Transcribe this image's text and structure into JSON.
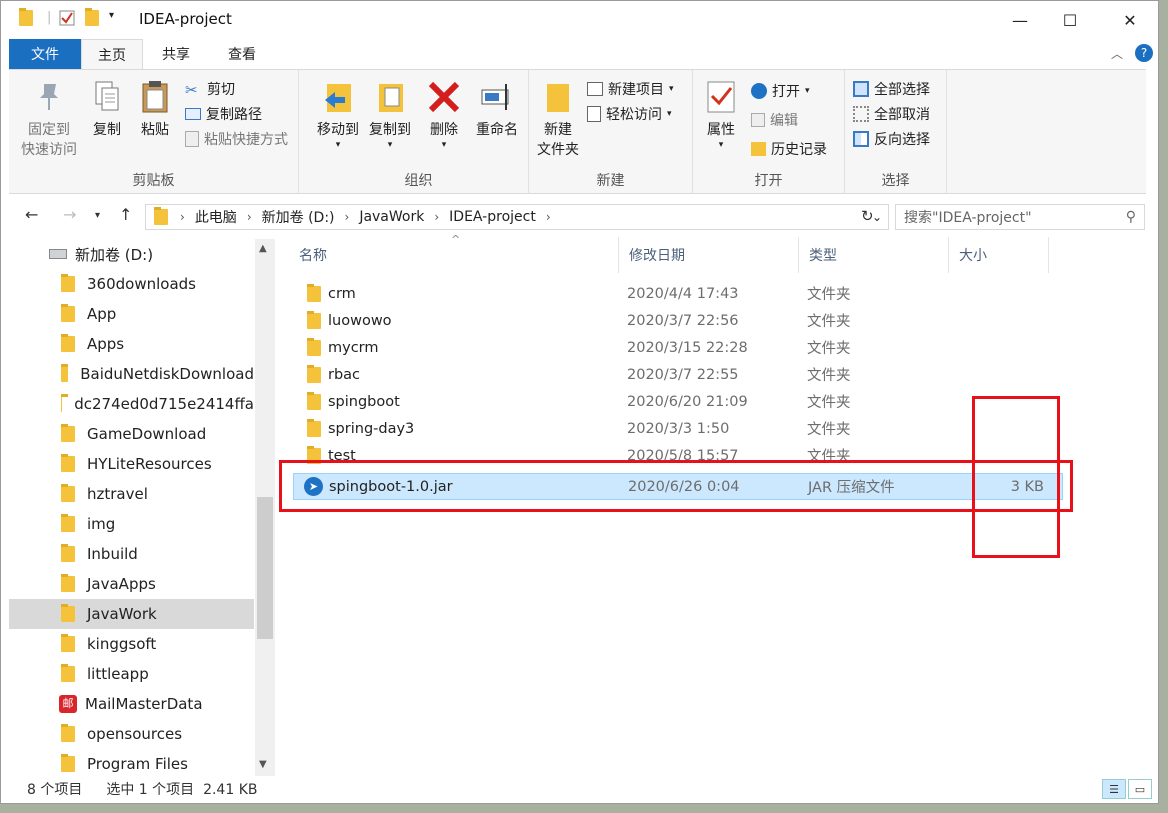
{
  "window": {
    "title": "IDEA-project"
  },
  "tabs": {
    "file": "文件",
    "home": "主页",
    "share": "共享",
    "view": "查看"
  },
  "ribbon": {
    "clipboard": {
      "group_label": "剪贴板",
      "pin": [
        "固定到",
        "快速访问"
      ],
      "copy": "复制",
      "paste": "粘贴",
      "cut": "剪切",
      "copy_path": "复制路径",
      "paste_shortcut": "粘贴快捷方式"
    },
    "organize": {
      "group_label": "组织",
      "move_to": "移动到",
      "copy_to": "复制到",
      "delete": "删除",
      "rename": "重命名"
    },
    "new": {
      "group_label": "新建",
      "new_folder": [
        "新建",
        "文件夹"
      ],
      "new_item": "新建项目",
      "easy_access": "轻松访问"
    },
    "open": {
      "group_label": "打开",
      "properties": "属性",
      "open": "打开",
      "edit": "编辑",
      "history": "历史记录"
    },
    "select": {
      "group_label": "选择",
      "select_all": "全部选择",
      "select_none": "全部取消",
      "invert": "反向选择"
    }
  },
  "address": {
    "crumbs": [
      "此电脑",
      "新加卷 (D:)",
      "JavaWork",
      "IDEA-project"
    ],
    "search_placeholder": "搜索\"IDEA-project\""
  },
  "nav": {
    "drive": "新加卷 (D:)",
    "items": [
      "360downloads",
      "App",
      "Apps",
      "BaiduNetdiskDownload",
      "dc274ed0d715e2414ffa",
      "GameDownload",
      "HYLiteResources",
      "hztravel",
      "img",
      "Inbuild",
      "JavaApps",
      "JavaWork",
      "kinggsoft",
      "littleapp",
      "MailMasterData",
      "opensources",
      "Program Files"
    ],
    "selected": "JavaWork",
    "mail_icon_text": "邮"
  },
  "columns": {
    "name": "名称",
    "date": "修改日期",
    "type": "类型",
    "size": "大小"
  },
  "files": [
    {
      "name": "crm",
      "date": "2020/4/4 17:43",
      "type": "文件夹",
      "size": ""
    },
    {
      "name": "luowowo",
      "date": "2020/3/7 22:56",
      "type": "文件夹",
      "size": ""
    },
    {
      "name": "mycrm",
      "date": "2020/3/15 22:28",
      "type": "文件夹",
      "size": ""
    },
    {
      "name": "rbac",
      "date": "2020/3/7 22:55",
      "type": "文件夹",
      "size": ""
    },
    {
      "name": "spingboot",
      "date": "2020/6/20 21:09",
      "type": "文件夹",
      "size": ""
    },
    {
      "name": "spring-day3",
      "date": "2020/3/3 1:50",
      "type": "文件夹",
      "size": ""
    },
    {
      "name": "test",
      "date": "2020/5/8 15:57",
      "type": "文件夹",
      "size": ""
    },
    {
      "name": "spingboot-1.0.jar",
      "date": "2020/6/26 0:04",
      "type": "JAR 压缩文件",
      "size": "3 KB"
    }
  ],
  "status": {
    "count": "8 个项目",
    "selection": "选中 1 个项目  2.41 KB"
  },
  "colors": {
    "accent": "#1a6fc1",
    "selection": "#cce8ff",
    "annotation": "#e8111a",
    "folder": "#f5c33b"
  }
}
